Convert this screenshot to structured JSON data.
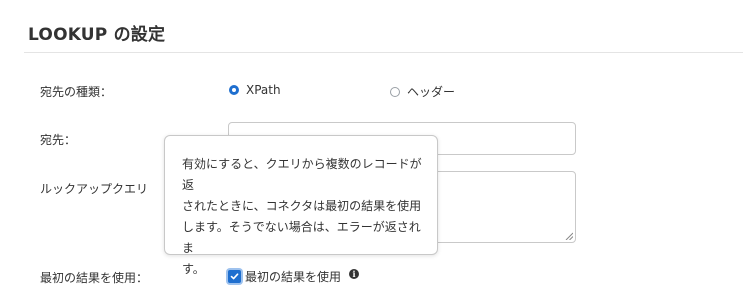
{
  "section": {
    "title": "LOOKUP の設定"
  },
  "destination_type": {
    "label": "宛先の種類：",
    "options": [
      {
        "label": "XPath",
        "selected": true
      },
      {
        "label": "ヘッダー",
        "selected": false
      }
    ]
  },
  "destination": {
    "label": "宛先："
  },
  "lookup_query": {
    "label": "ルックアップクエリ"
  },
  "use_first_result": {
    "label": "最初の結果を使用：",
    "checkbox_label": "最初の結果を使用",
    "checked": true
  },
  "tooltip": {
    "lines": [
      "有効にすると、クエリから複数のレコードが返",
      "されたときに、コネクタは最初の結果を使用",
      "します。そうでない場合は、エラーが返されま",
      "す。"
    ]
  },
  "colors": {
    "accent": "#1f6fcf"
  },
  "icons": {
    "info": "info-icon",
    "check": "check-icon",
    "resize": "resize-grip-icon"
  }
}
